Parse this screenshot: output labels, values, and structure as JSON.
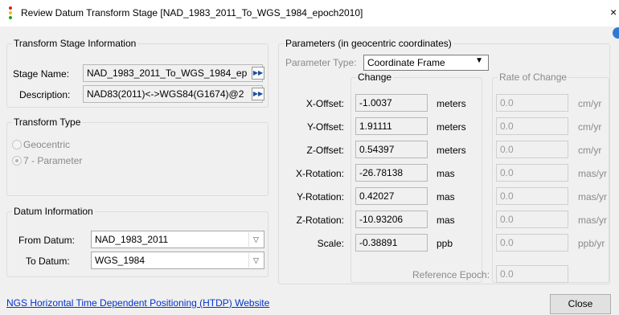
{
  "window": {
    "title": "Review Datum Transform Stage [NAD_1983_2011_To_WGS_1984_epoch2010]",
    "close_glyph": "×"
  },
  "stage_info": {
    "group_title": "Transform Stage Information",
    "name_label": "Stage Name:",
    "name_value": "NAD_1983_2011_To_WGS_1984_ep",
    "description_label": "Description:",
    "description_value": "NAD83(2011)<->WGS84(G1674)@2"
  },
  "transform_type": {
    "group_title": "Transform Type",
    "options": [
      "Geocentric",
      "7 - Parameter"
    ],
    "selected": "7 - Parameter"
  },
  "datum_info": {
    "group_title": "Datum Information",
    "from_label": "From Datum:",
    "from_value": "NAD_1983_2011",
    "to_label": "To Datum:",
    "to_value": "WGS_1984"
  },
  "parameters": {
    "group_title": "Parameters (in geocentric coordinates)",
    "type_label": "Parameter Type:",
    "type_value": "Coordinate Frame",
    "change_title": "Change",
    "rate_title": "Rate of Change",
    "rows": [
      {
        "label": "X-Offset:",
        "value": "-1.0037",
        "unit": "meters",
        "rate": "0.0",
        "rate_unit": "cm/yr"
      },
      {
        "label": "Y-Offset:",
        "value": "1.91111",
        "unit": "meters",
        "rate": "0.0",
        "rate_unit": "cm/yr"
      },
      {
        "label": "Z-Offset:",
        "value": "0.54397",
        "unit": "meters",
        "rate": "0.0",
        "rate_unit": "cm/yr"
      },
      {
        "label": "X-Rotation:",
        "value": "-26.78138",
        "unit": "mas",
        "rate": "0.0",
        "rate_unit": "mas/yr"
      },
      {
        "label": "Y-Rotation:",
        "value": "0.42027",
        "unit": "mas",
        "rate": "0.0",
        "rate_unit": "mas/yr"
      },
      {
        "label": "Z-Rotation:",
        "value": "-10.93206",
        "unit": "mas",
        "rate": "0.0",
        "rate_unit": "mas/yr"
      },
      {
        "label": "Scale:",
        "value": "-0.38891",
        "unit": "ppb",
        "rate": "0.0",
        "rate_unit": "ppb/yr"
      }
    ],
    "ref_epoch_label": "Reference Epoch:",
    "ref_epoch_value": "0.0"
  },
  "footer": {
    "link_text": "NGS Horizontal Time Dependent Positioning (HTDP) Website",
    "close_label": "Close"
  },
  "icons": {
    "app": "stacked-dots-icon",
    "more": "double-arrow-right-icon",
    "dropdown": "chevron-down-icon",
    "help": "help-icon"
  },
  "colors": {
    "window_bg": "#f0f0f0",
    "link": "#0033cc",
    "icon_red": "#e02020",
    "icon_yellow": "#f0c000",
    "icon_green": "#20a020",
    "help_blue": "#2d7ad6"
  }
}
